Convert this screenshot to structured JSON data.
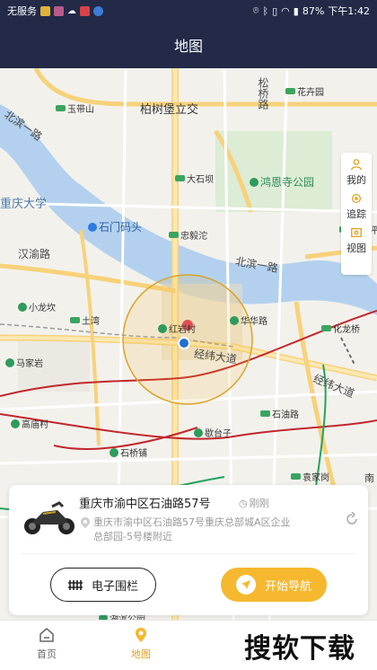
{
  "statusbar": {
    "carrier": "无服务",
    "battery": "87%",
    "time": "下午1:42"
  },
  "header": {
    "title": "地图"
  },
  "map": {
    "labels": {
      "baisuyuan": "柏树堡立交",
      "songqiao": "松桥路",
      "huakaiyuan": "花卉园",
      "yudaishan": "玉带山",
      "beibin_left": "北滨一路",
      "daishiba": "大石坝",
      "hongensi": "鸿恩寺公园",
      "chongqing_univ": "重庆大学",
      "shimen": "石门码头",
      "zhongsuotuo": "忠毅沱",
      "lijiaping": "李家坪",
      "hanyu": "汉渝路",
      "beibin_right": "北滨一路",
      "xiaolongkan": "小龙坎",
      "tuwan": "土湾",
      "hongyancun": "红岩村",
      "huahualu": "华华路",
      "huahuaqiao": "化龙桥",
      "jingwei": "经纬大道",
      "majiayan": "马家岩",
      "jingwei_right": "经纬大道",
      "gaomiaocun": "高庙村",
      "shiyoulu": "石油路",
      "xietaiyu": "歇台子",
      "shiqiaopu": "石桥铺",
      "yuanjiagang": "袁家岗",
      "hulei": "湖滨公园",
      "nan": "南"
    },
    "controls": {
      "mine": "我的",
      "track": "追踪",
      "view": "视图"
    }
  },
  "card": {
    "address": "重庆市渝中区石油路57号",
    "time": "刚刚",
    "detail": "重庆市渝中区石油路57号重庆总部城A区企业总部园-5号楼附近"
  },
  "buttons": {
    "fence": "电子围栏",
    "navigate": "开始导航"
  },
  "bottomnav": {
    "home": "首页",
    "map": "地图"
  },
  "watermark": "搜软下载",
  "colors": {
    "header_bg": "#222a47",
    "accent": "#f5b82e",
    "river": "#b3d1ee"
  }
}
